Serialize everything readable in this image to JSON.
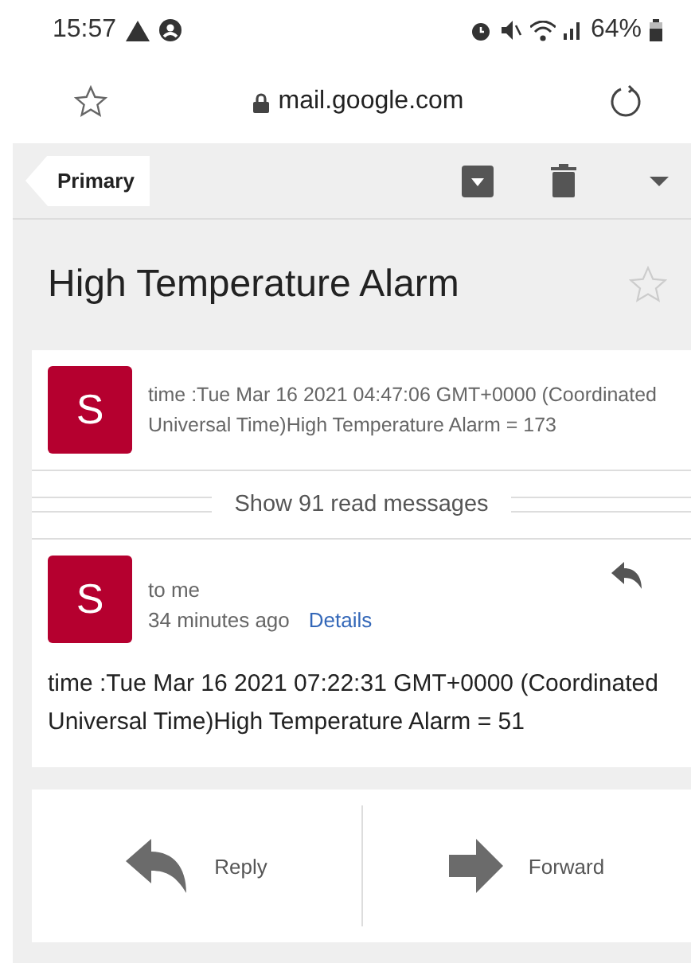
{
  "status_bar": {
    "time": "15:57",
    "battery": "64%"
  },
  "browser": {
    "url": "mail.google.com"
  },
  "toolbar": {
    "back_label": "Primary"
  },
  "subject": {
    "title": "High Temperature Alarm",
    "starred": false
  },
  "collapsed_message": {
    "avatar": "S",
    "snippet": "time :Tue Mar 16 2021 04:47:06 GMT+0000 (Coordinated Universal Time)High Temperature Alarm = 173"
  },
  "read_messages": {
    "label": "Show 91 read messages"
  },
  "message": {
    "avatar": "S",
    "recipient": "to me",
    "age": "34 minutes ago",
    "details_link": "Details",
    "body": "time :Tue Mar 16 2021 07:22:31 GMT+0000 (Coordinated Universal Time)High Temperature Alarm = 51"
  },
  "actions": [
    {
      "kind": "reply",
      "label": "Reply"
    },
    {
      "kind": "forward",
      "label": "Forward"
    }
  ]
}
